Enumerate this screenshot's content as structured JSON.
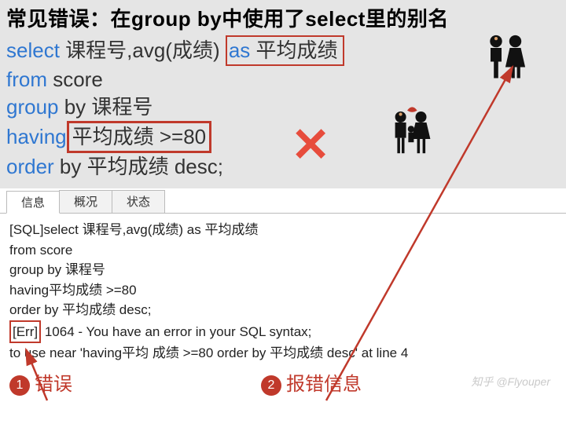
{
  "heading": "常见错误：在group by中使用了select里的别名",
  "sql": {
    "select_kw": "select",
    "select_cols": " 课程号,avg(成绩) ",
    "as_kw": "as",
    "alias": " 平均成绩",
    "from_kw": "from",
    "from_tbl": " score",
    "group_kw": "group",
    "by_kw": " by ",
    "group_col": "课程号",
    "having_kw": "having",
    "having_cond": "平均成绩 >=80",
    "order_kw": "order",
    "order_rest": " by 平均成绩 desc;"
  },
  "cross_mark": "✕",
  "tabs": [
    "信息",
    "概况",
    "状态"
  ],
  "result_lines": {
    "l1": "[SQL]select 课程号,avg(成绩) as 平均成绩",
    "l2": "from score",
    "l3": "group by 课程号",
    "l4": "having平均成绩 >=80",
    "l5": "order by 平均成绩 desc;",
    "err_label": "[Err]",
    "l6_rest": " 1064 - You have an error in your SQL syntax;",
    "l7": "to use near 'having平均 成绩 >=80     order by 平均成绩 desc' at line 4"
  },
  "footer": {
    "num1": "1",
    "label1": "错误",
    "num2": "2",
    "label2": "报错信息"
  },
  "watermark": "知乎 @Flyouper"
}
